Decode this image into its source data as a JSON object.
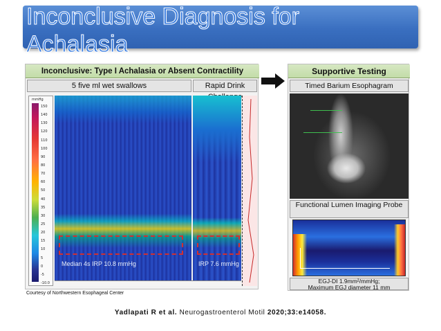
{
  "slide": {
    "title": "Inconclusive Diagnosis for Achalasia"
  },
  "left_figure": {
    "header": "Inconclusive: Type I Achalasia or Absent Contractility",
    "sub_a": "5 five ml wet swallows",
    "sub_b": "Rapid Drink Challenge",
    "label_a": "Median 4s IRP 10.8 mmHg",
    "label_b": "IRP 7.6 mmHg",
    "scale_unit": "mmHg",
    "scale_ticks": [
      "150",
      "140",
      "130",
      "120",
      "110",
      "100",
      "90",
      "80",
      "70",
      "60",
      "50",
      "40",
      "35",
      "30",
      "25",
      "20",
      "15",
      "10",
      "5",
      "0",
      "-5",
      "-10.0"
    ]
  },
  "right_figure": {
    "header": "Supportive Testing",
    "barium_label": "Timed Barium Esophagram",
    "flip_label": "Functional Lumen Imaging Probe",
    "flip_caption_1": "EGJ-DI 1.9mm²/mmHg;",
    "flip_caption_2": "Maximum EGJ diameter 11 mm"
  },
  "footer": {
    "courtesy": "Courtesy of Northwestern Esophageal Center",
    "citation_authors": "Yadlapati R et al.",
    "citation_journal": "Neurogastroenterol Motil",
    "citation_ref": "2020;33:e14058."
  },
  "colors": {
    "banner": "#3a6fc0",
    "panel_header": "#c2dca8"
  }
}
